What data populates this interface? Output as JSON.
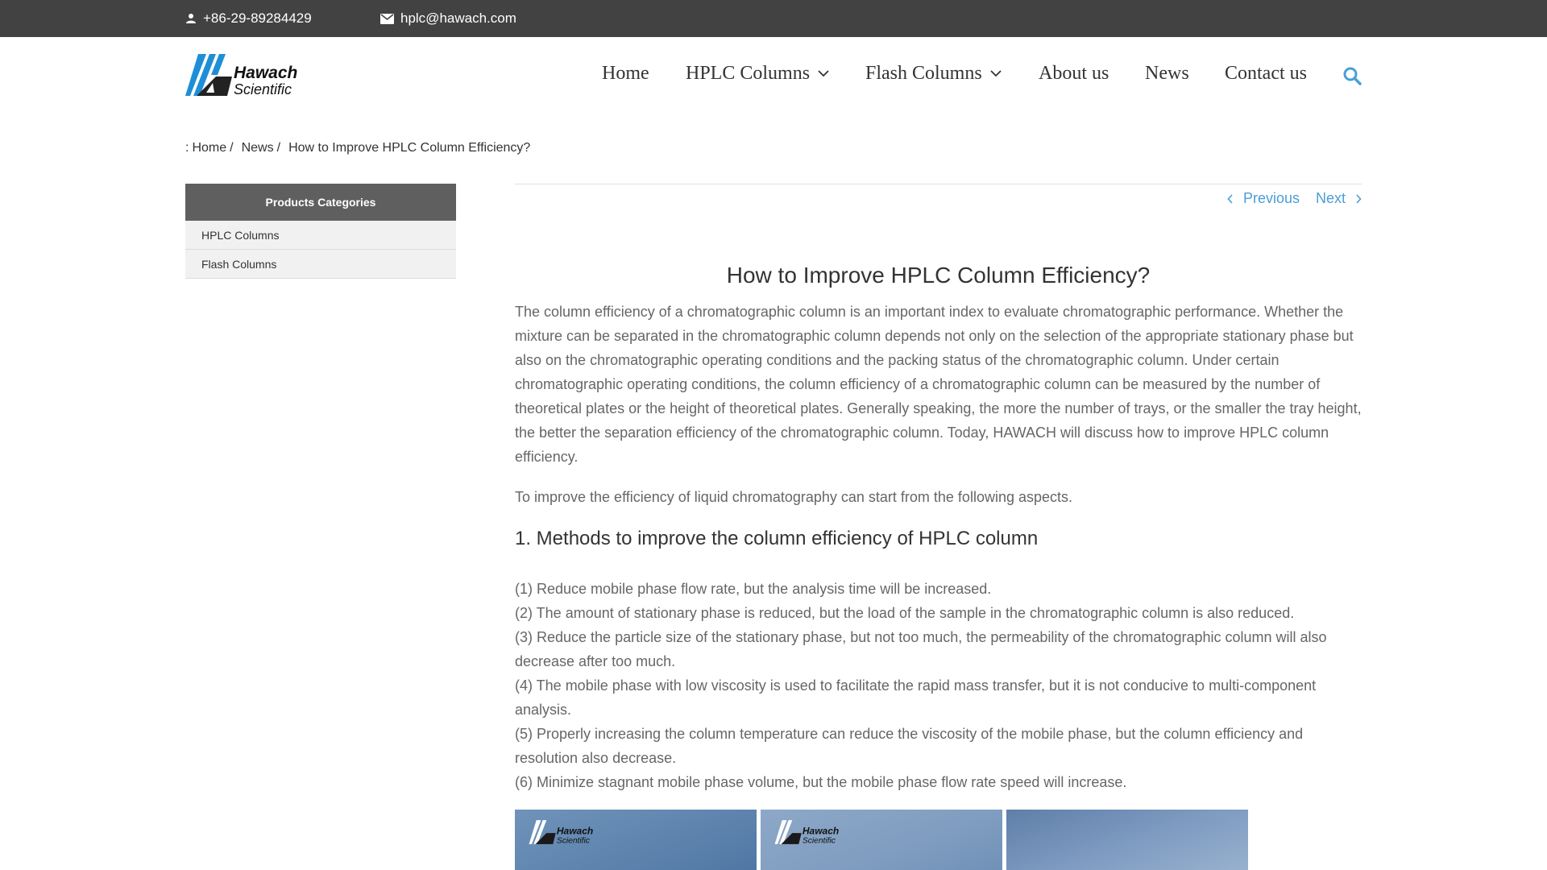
{
  "topbar": {
    "phone": "+86-29-89284429",
    "email": "hplc@hawach.com",
    "phone_icon": "user-icon",
    "email_icon": "envelope-icon"
  },
  "brand": {
    "logo_word1": "Hawach",
    "logo_word2": "Scientific",
    "accent_color": "#1e8fd6"
  },
  "nav": {
    "items": [
      {
        "label": "Home"
      },
      {
        "label": "HPLC Columns"
      },
      {
        "label": "Flash Columns"
      },
      {
        "label": "About us"
      },
      {
        "label": "News"
      },
      {
        "label": "Contact us"
      }
    ],
    "search_icon": "search-icon"
  },
  "breadcrumb": {
    "prefix": ":",
    "home": "Home",
    "sep": "/",
    "news": "News",
    "current": "How to Improve HPLC Column Efficiency?"
  },
  "sidebar": {
    "heading": "Products Categories",
    "items": [
      {
        "label": "HPLC Columns"
      },
      {
        "label": "Flash Columns"
      }
    ]
  },
  "article": {
    "prev_label": "Previous",
    "next_label": "Next",
    "title": "How to Improve HPLC Column Efficiency?",
    "intro": "The column efficiency of a chromatographic column is an important index to evaluate chromatographic performance. Whether the mixture can be separated in the chromatographic column depends not only on the selection of the appropriate stationary phase but also on the chromatographic operating conditions and the packing status of the chromatographic column. Under certain chromatographic operating conditions, the column efficiency of a chromatographic column can be measured by the number of theoretical plates or the height of theoretical plates. Generally speaking, the more the number of trays, or the smaller the tray height, the better the separation efficiency of the chromatographic column. Today, HAWACH will discuss how to improve HPLC column efficiency.",
    "lead": "To improve the efficiency of liquid chromatography can start from the following aspects.",
    "section1_title": "1. Methods to improve the column efficiency of HPLC column",
    "methods": [
      "(1) Reduce mobile phase flow rate, but the analysis time will be increased.",
      "(2) The amount of stationary phase is reduced, but the load of the sample in the chromatographic column is also reduced.",
      "(3) Reduce the particle size of the stationary phase, but not too much, the permeability of the chromatographic column will also decrease after too much.",
      "(4) The mobile phase with low viscosity is used to facilitate the rapid mass transfer, but it is not conducive to multi-component analysis.",
      "(5) Properly increasing the column temperature can reduce the viscosity of the mobile phase, but the column efficiency and resolution also decrease.",
      "(6) Minimize stagnant mobile phase volume, but the mobile phase flow rate speed will increase."
    ]
  }
}
